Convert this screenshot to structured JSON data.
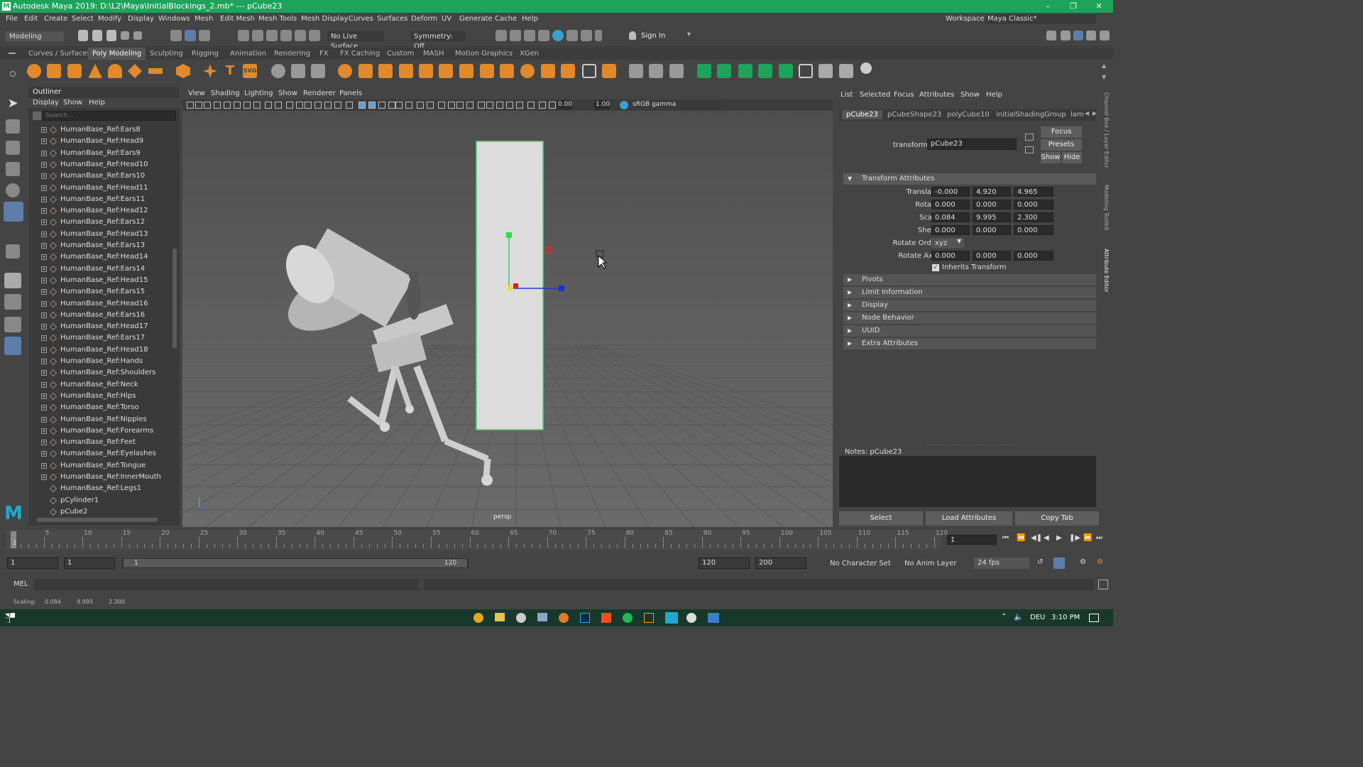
{
  "window": {
    "title": "Autodesk Maya 2019: D:\\L2\\Maya\\InitialBlockings_2.mb*   ---   pCube23"
  },
  "menu": [
    "File",
    "Edit",
    "Create",
    "Select",
    "Modify",
    "Display",
    "Windows",
    "Mesh",
    "Edit Mesh",
    "Mesh Tools",
    "Mesh Display",
    "Curves",
    "Surfaces",
    "Deform",
    "UV",
    "Generate",
    "Cache",
    "Help"
  ],
  "workspace": {
    "label": "Workspace :",
    "value": "Maya Classic*"
  },
  "statusline": {
    "mode": "Modeling",
    "live_surface": "No Live Surface",
    "symmetry": "Symmetry: Off",
    "sign_in": "Sign In"
  },
  "shelf_tabs": [
    "Curves / Surfaces",
    "Poly Modeling",
    "Sculpting",
    "Rigging",
    "Animation",
    "Rendering",
    "FX",
    "FX Caching",
    "Custom",
    "MASH",
    "Motion Graphics",
    "XGen"
  ],
  "shelf_active": "Poly Modeling",
  "shelf_svg_label": "SVG",
  "outliner": {
    "title": "Outliner",
    "menu": [
      "Display",
      "Show",
      "Help"
    ],
    "search_placeholder": "Search...",
    "items": [
      "HumanBase_Ref:Ears8",
      "HumanBase_Ref:Head9",
      "HumanBase_Ref:Ears9",
      "HumanBase_Ref:Head10",
      "HumanBase_Ref:Ears10",
      "HumanBase_Ref:Head11",
      "HumanBase_Ref:Ears11",
      "HumanBase_Ref:Head12",
      "HumanBase_Ref:Ears12",
      "HumanBase_Ref:Head13",
      "HumanBase_Ref:Ears13",
      "HumanBase_Ref:Head14",
      "HumanBase_Ref:Ears14",
      "HumanBase_Ref:Head15",
      "HumanBase_Ref:Ears15",
      "HumanBase_Ref:Head16",
      "HumanBase_Ref:Ears16",
      "HumanBase_Ref:Head17",
      "HumanBase_Ref:Ears17",
      "HumanBase_Ref:Head18",
      "HumanBase_Ref:Hands",
      "HumanBase_Ref:Shoulders",
      "HumanBase_Ref:Neck",
      "HumanBase_Ref:Hips",
      "HumanBase_Ref:Torso",
      "HumanBase_Ref:Nipples",
      "HumanBase_Ref:Forearms",
      "HumanBase_Ref:Feet",
      "HumanBase_Ref:Eyelashes",
      "HumanBase_Ref:Tongue",
      "HumanBase_Ref:InnerMouth",
      "HumanBase_Ref:Legs1",
      "pCylinder1",
      "pCube2"
    ]
  },
  "viewport": {
    "menu": [
      "View",
      "Shading",
      "Lighting",
      "Show",
      "Renderer",
      "Panels"
    ],
    "exposure": "0.00",
    "gamma": "1.00",
    "color_space": "sRGB gamma",
    "camera": "persp"
  },
  "attribute_editor": {
    "menu": [
      "List",
      "Selected",
      "Focus",
      "Attributes",
      "Show",
      "Help"
    ],
    "tabs": [
      "pCube23",
      "pCubeShape23",
      "polyCube10",
      "initialShadingGroup",
      "lam"
    ],
    "transform_label": "transform:",
    "transform_value": "pCube23",
    "buttons": {
      "focus": "Focus",
      "presets": "Presets",
      "show": "Show",
      "hide": "Hide"
    },
    "section_title": "Transform Attributes",
    "translate": {
      "label": "Translate",
      "x": "-0.000",
      "y": "4.920",
      "z": "4.965"
    },
    "rotate": {
      "label": "Rotate",
      "x": "0.000",
      "y": "0.000",
      "z": "0.000"
    },
    "scale": {
      "label": "Scale",
      "x": "0.084",
      "y": "9.995",
      "z": "2.300"
    },
    "shear": {
      "label": "Shear",
      "x": "0.000",
      "y": "0.000",
      "z": "0.000"
    },
    "rotate_order": {
      "label": "Rotate Order",
      "value": "xyz"
    },
    "rotate_axis": {
      "label": "Rotate Axis",
      "x": "0.000",
      "y": "0.000",
      "z": "0.000"
    },
    "inherits": "Inherits Transform",
    "sections": [
      "Pivots",
      "Limit Information",
      "Display",
      "Node Behavior",
      "UUID",
      "Extra Attributes"
    ],
    "notes": "Notes:  pCube23",
    "bottom_buttons": [
      "Select",
      "Load Attributes",
      "Copy Tab"
    ]
  },
  "side_tabs": [
    "Channel Box / Layer Editor",
    "Modeling Toolkit",
    "Attribute Editor"
  ],
  "timeline": {
    "ticks": [
      "5",
      "10",
      "15",
      "20",
      "25",
      "30",
      "35",
      "40",
      "45",
      "50",
      "55",
      "60",
      "65",
      "70",
      "75",
      "80",
      "85",
      "90",
      "95",
      "100",
      "105",
      "110",
      "115",
      "120"
    ],
    "first": "1",
    "current": "1"
  },
  "range": {
    "start": "1",
    "start2": "1",
    "slider_start": "1",
    "slider_end": "120",
    "end": "120",
    "end2": "200",
    "char_set": "No Character Set",
    "anim_layer": "No Anim Layer",
    "fps": "24 fps"
  },
  "cmd": {
    "label": "MEL"
  },
  "help": {
    "label": "Scaling:",
    "x": "0.084",
    "y": "9.995",
    "z": "2.300"
  },
  "taskbar": {
    "lang": "DEU",
    "time": "3:10 PM"
  },
  "colors": {
    "accent": "#1da35a",
    "selection": "#3a9aff"
  }
}
